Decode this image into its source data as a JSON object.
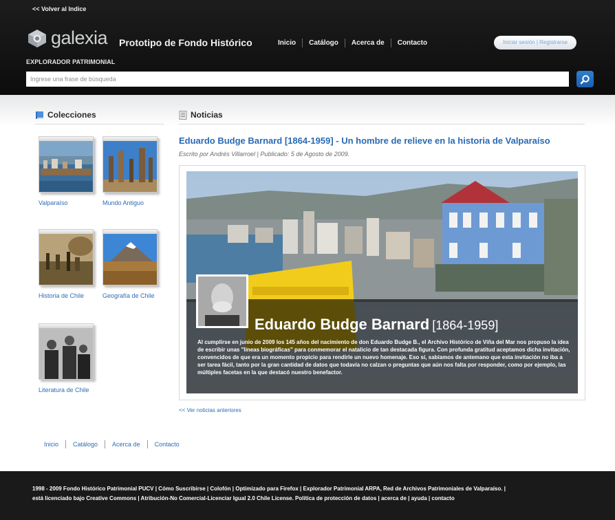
{
  "header": {
    "back_link": "<< Volver al Indice",
    "logo_text": "galexia",
    "site_title": "Prototipo de Fondo Histórico",
    "explorer_label": "EXPLORADOR PATRIMONIAL",
    "nav": [
      "Inicio",
      "Catálogo",
      "Acerca de",
      "Contacto"
    ],
    "login_label": "Iniciar sesión | Registrarse",
    "search_placeholder": "Ingrese una frase de búsqueda",
    "search_icon": "magnifier-icon"
  },
  "collections": {
    "heading": "Colecciones",
    "icon": "book-icon",
    "items": [
      {
        "label": "Valparaíso"
      },
      {
        "label": "Mundo Antiguo"
      },
      {
        "label": "Historia de Chile"
      },
      {
        "label": "Geografía de Chile"
      },
      {
        "label": "Literatura de Chile"
      }
    ]
  },
  "news": {
    "heading": "Noticias",
    "icon": "document-icon",
    "title": "Eduardo Budge Barnard [1864-1959] - Un hombre de relieve en la historia de Valparaíso",
    "byline": "Escrito por Andrés Villarroel | Publicado: 5 de Agosto de 2009.",
    "feature_name": "Eduardo Budge Barnard",
    "feature_years": "[1864-1959]",
    "feature_text": "Al cumplirse en junio de 2009 los 145 años del nacimiento de don Eduardo Budge B., el Archivo Histórico de Viña del Mar nos propuso la idea de escribir unas \"líneas biográficas\" para conmemorar el natalicio de tan destacada figura. Con profunda gratitud aceptamos dicha invitación, convencidos de que era un momento propicio para rendirle un nuevo homenaje. Eso sí, sabíamos de antemano que esta invitación no iba a ser tarea fácil, tanto por la gran cantidad de datos que todavía no calzan o preguntas que aún nos falta por responder, como por ejemplo, las múltiples facetas en la que destacó nuestro benefactor.",
    "older_link": "<< Ver noticias anteriores"
  },
  "footer_nav": [
    "Inicio",
    "Catálogo",
    "Acerca de",
    "Contacto"
  ],
  "footer": {
    "line1": "1998 - 2009 Fondo Histórico Patrimonial PUCV | Cómo Suscribirse | Colofón | Optimizado para Firefox | Explorador Patrimonial ARPA, Red de Archivos Patrimoniales de Valparaíso. |",
    "line2": "está licenciado bajo Creative Commons | Atribución-No Comercial-Licenciar Igual 2.0 Chile License. Política de protección de datos | acerca de | ayuda | contacto"
  },
  "colors": {
    "header_bg": "#111111",
    "link_blue": "#2e6cb4",
    "title_blue": "#2a6ab2",
    "search_button": "#1f66b8",
    "footer_bg": "#1a1a1a"
  }
}
